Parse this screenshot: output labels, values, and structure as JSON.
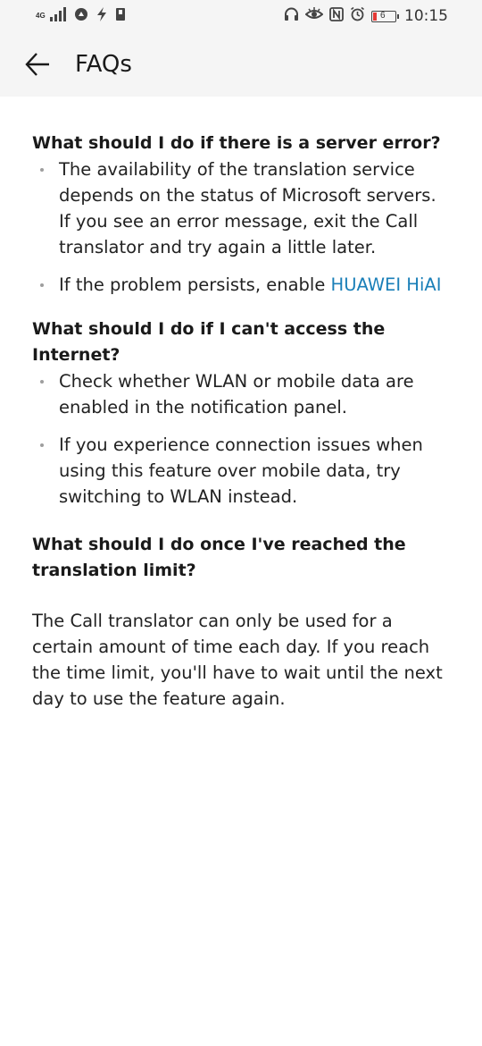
{
  "status_bar": {
    "network": "4G",
    "time": "10:15",
    "battery_level": "6",
    "icons": [
      "signal-icon",
      "wifi-hotspot-icon",
      "charging-icon",
      "sim-icon",
      "headset-icon",
      "eye-comfort-icon",
      "nfc-icon",
      "alarm-icon",
      "battery-icon"
    ]
  },
  "header": {
    "title": "FAQs",
    "back_icon": "arrow-left-icon"
  },
  "faq": {
    "q1": {
      "question": "What should I do if there is a server error?",
      "answers": [
        "The availability of the translation service depends on the status of Microsoft servers. If you see an error message, exit the Call translator and try again a little later."
      ],
      "persist_text": "If the problem persists, enable ",
      "link_text": "HUAWEI HiAI"
    },
    "q2": {
      "question": "What should I do if I can't access the Internet?",
      "answers": [
        "Check whether WLAN or mobile data are enabled in the notification panel.",
        "If you experience connection issues when using this feature over mobile data, try switching to WLAN instead."
      ]
    },
    "q3": {
      "question": "What should I do once I've reached the translation limit?",
      "answer": "The Call translator can only be used for a certain amount of time each day. If you reach the time limit, you'll have to wait until the next day to use the feature again."
    }
  },
  "colors": {
    "link": "#1a7fb8",
    "header_bg": "#f5f5f5",
    "battery_low": "#e53935"
  }
}
